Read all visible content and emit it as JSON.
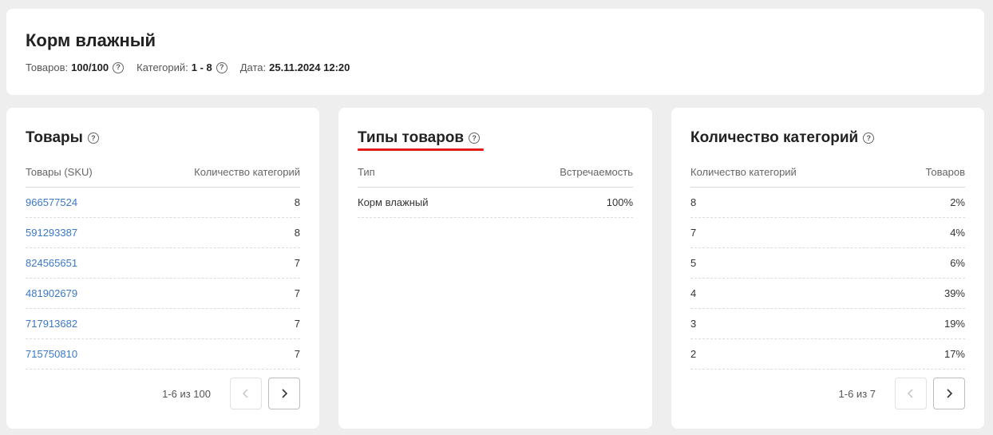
{
  "header": {
    "title": "Корм влажный",
    "meta": {
      "products_label": "Товаров:",
      "products_value": "100/100",
      "categories_label": "Категорий:",
      "categories_value": "1 - 8",
      "date_label": "Дата:",
      "date_value": "25.11.2024 12:20"
    }
  },
  "panels": {
    "products": {
      "title": "Товары",
      "columns": [
        "Товары (SKU)",
        "Количество категорий"
      ],
      "rows": [
        {
          "sku": "966577524",
          "count": "8"
        },
        {
          "sku": "591293387",
          "count": "8"
        },
        {
          "sku": "824565651",
          "count": "7"
        },
        {
          "sku": "481902679",
          "count": "7"
        },
        {
          "sku": "717913682",
          "count": "7"
        },
        {
          "sku": "715750810",
          "count": "7"
        }
      ],
      "pager": "1-6 из 100"
    },
    "types": {
      "title": "Типы товаров",
      "columns": [
        "Тип",
        "Встречаемость"
      ],
      "rows": [
        {
          "type": "Корм влажный",
          "share": "100%"
        }
      ]
    },
    "category_count": {
      "title": "Количество категорий",
      "columns": [
        "Количество категорий",
        "Товаров"
      ],
      "rows": [
        {
          "count": "8",
          "share": "2%"
        },
        {
          "count": "7",
          "share": "4%"
        },
        {
          "count": "5",
          "share": "6%"
        },
        {
          "count": "4",
          "share": "39%"
        },
        {
          "count": "3",
          "share": "19%"
        },
        {
          "count": "2",
          "share": "17%"
        }
      ],
      "pager": "1-6 из 7"
    }
  },
  "icons": {
    "help": "question-circle-icon",
    "prev": "chevron-left-icon",
    "next": "chevron-right-icon"
  },
  "colors": {
    "link": "#3a78c9",
    "active_underline": "#e21b1b",
    "background": "#eeeeee"
  }
}
